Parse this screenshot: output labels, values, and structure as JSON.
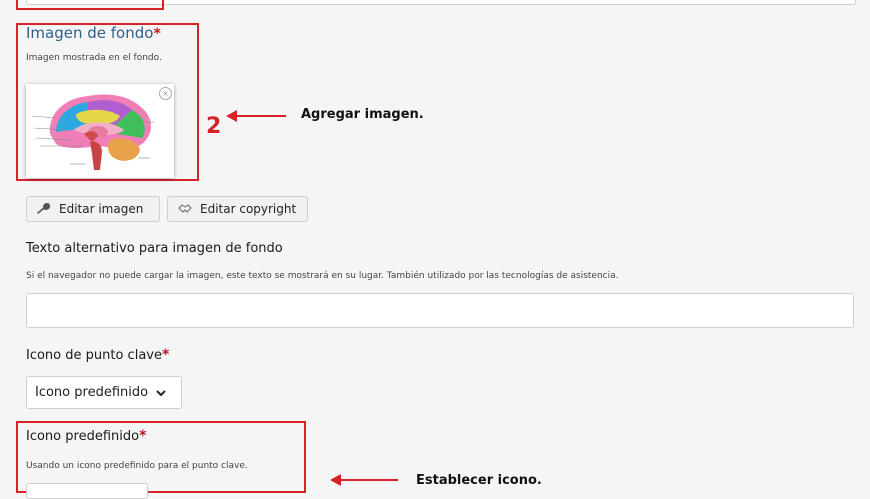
{
  "background_image": {
    "title": "Imagen de fondo",
    "required_mark": "*",
    "description": "Imagen mostrada en el fondo.",
    "remove_glyph": "×"
  },
  "annotation_image": {
    "number": "2",
    "text": "Agregar imagen."
  },
  "buttons": {
    "edit_image": "Editar imagen",
    "edit_copyright": "Editar copyright"
  },
  "alt_text": {
    "label": "Texto alternativo para imagen de fondo",
    "description": "Si el navegador no puede cargar la imagen, este texto se mostrará en su lugar. También utilizado por las tecnologías de asistencia.",
    "value": ""
  },
  "hotspot_icon": {
    "label": "Icono de punto clave",
    "required_mark": "*",
    "selected": "Icono predefinido"
  },
  "predefined_icon": {
    "label": "Icono predefinido",
    "required_mark": "*",
    "description": "Usando un icono predefinido para el punto clave."
  },
  "annotation_icon": {
    "text": "Establecer icono."
  },
  "colors": {
    "highlight_red": "#d8222a",
    "title_blue": "#2e5f8a"
  }
}
